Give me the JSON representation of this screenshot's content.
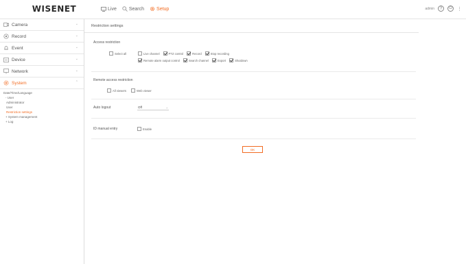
{
  "header": {
    "logo": "WISENET",
    "nav": [
      {
        "label": "Live",
        "icon": "monitor-icon"
      },
      {
        "label": "Search",
        "icon": "search-icon"
      },
      {
        "label": "Setup",
        "icon": "gear-icon",
        "active": true
      }
    ],
    "user": "admin",
    "accent_color": "#f26b21"
  },
  "sidebar": {
    "items": [
      {
        "label": "Camera",
        "icon": "camera-icon"
      },
      {
        "label": "Record",
        "icon": "record-icon"
      },
      {
        "label": "Event",
        "icon": "bell-icon"
      },
      {
        "label": "Device",
        "icon": "device-icon"
      },
      {
        "label": "Network",
        "icon": "network-icon"
      },
      {
        "label": "System",
        "icon": "system-icon",
        "active": true
      }
    ],
    "submenu": [
      {
        "label": "Date/Time/Language",
        "level": 1
      },
      {
        "label": "User",
        "level": 2
      },
      {
        "label": "Administrator",
        "level": 3
      },
      {
        "label": "User",
        "level": 3
      },
      {
        "label": "Restriction settings",
        "level": 3,
        "current": true
      },
      {
        "label": "System management",
        "level": 2
      },
      {
        "label": "Log",
        "level": 2
      }
    ]
  },
  "main": {
    "title": "Restriction settings",
    "access": {
      "title": "Access restriction",
      "select_all": "Select all",
      "row1": [
        {
          "label": "Live channel",
          "checked": false
        },
        {
          "label": "PTZ control",
          "checked": true
        },
        {
          "label": "Record",
          "checked": true
        },
        {
          "label": "Stop recording",
          "checked": true
        }
      ],
      "row2": [
        {
          "label": "Remote alarm output control",
          "checked": true
        },
        {
          "label": "Search channel",
          "checked": true
        },
        {
          "label": "Export",
          "checked": true
        },
        {
          "label": "Shutdown",
          "checked": true
        }
      ]
    },
    "remote": {
      "title": "Remote access restriction",
      "options": [
        {
          "label": "All viewers",
          "checked": false
        },
        {
          "label": "Web viewer",
          "checked": false
        }
      ]
    },
    "auto_logout": {
      "label": "Auto logout",
      "value": "Off"
    },
    "id_manual": {
      "label": "ID manual entry",
      "option": "Enable",
      "checked": false
    },
    "ok_label": "OK"
  }
}
